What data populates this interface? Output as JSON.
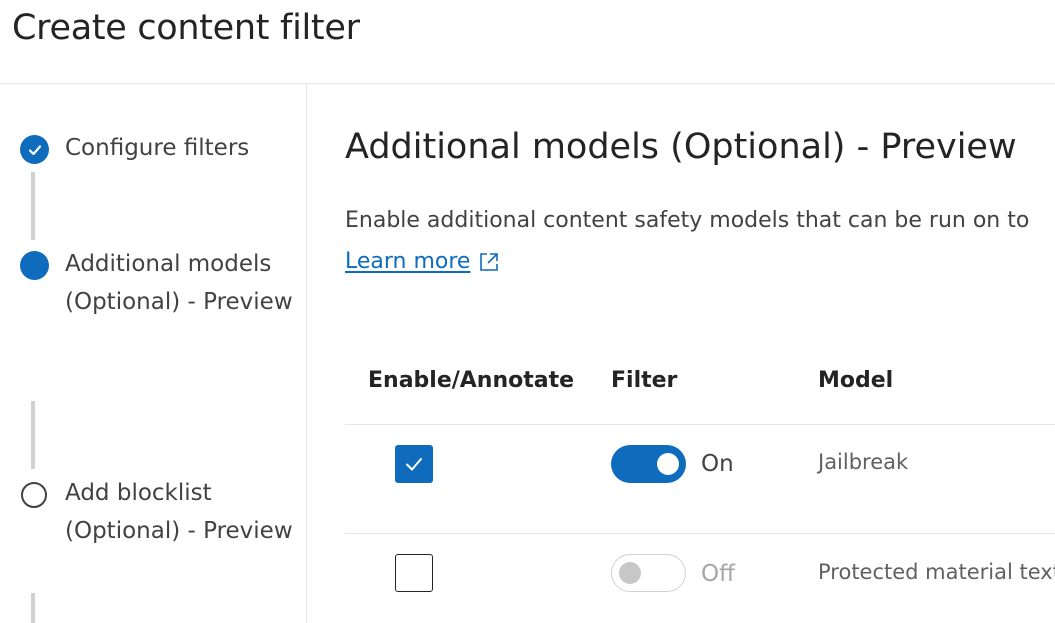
{
  "page": {
    "title": "Create content filter"
  },
  "steps": [
    {
      "label": "Configure filters",
      "status": "completed"
    },
    {
      "label": "Additional models (Optional) - Preview",
      "status": "current"
    },
    {
      "label": "Add blocklist (Optional) - Preview",
      "status": "pending"
    }
  ],
  "main": {
    "section_title": "Additional models (Optional) - Preview",
    "description": "Enable additional content safety models that can be run on to",
    "learn_more": "Learn more",
    "table": {
      "headers": {
        "enable": "Enable/Annotate",
        "filter": "Filter",
        "model": "Model"
      },
      "rows": [
        {
          "enabled": true,
          "filter_on": true,
          "filter_state": "On",
          "model": "Jailbreak"
        },
        {
          "enabled": false,
          "filter_on": false,
          "filter_state": "Off",
          "model": "Protected material text"
        }
      ]
    }
  },
  "colors": {
    "accent": "#0f6cbd",
    "divider": "#e6e6e6",
    "connector": "#d1d1d1"
  },
  "icons": {
    "completed_step": "check-circle-icon",
    "current_step": "filled-circle-icon",
    "pending_step": "empty-circle-icon",
    "external_link": "open-external-icon",
    "checkmark": "checkmark-icon"
  }
}
